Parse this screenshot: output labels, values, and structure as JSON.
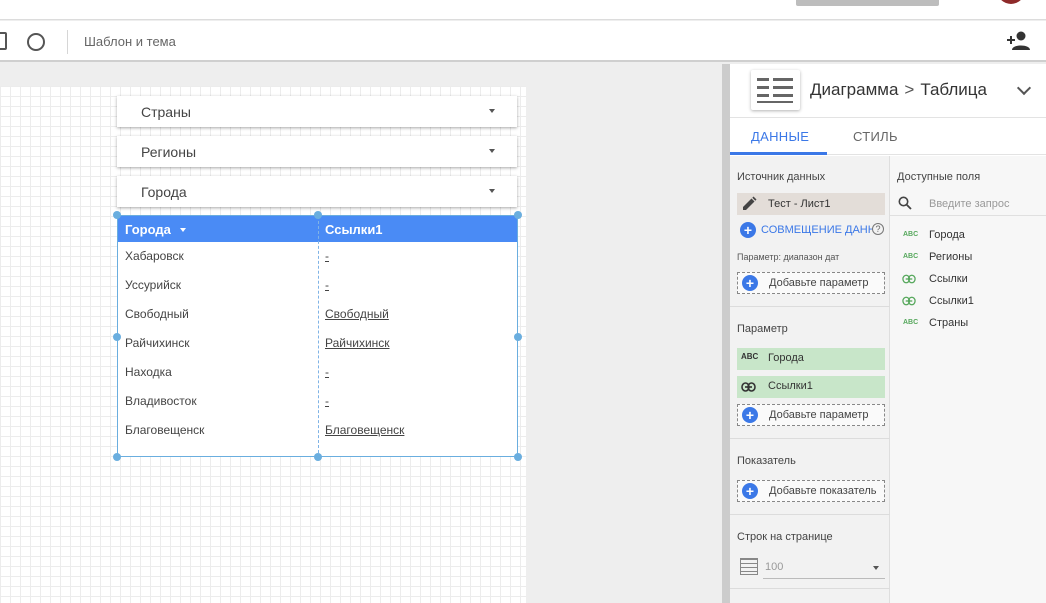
{
  "toolbar": {
    "theme_label": "Шаблон и тема"
  },
  "filters": [
    {
      "label": "Страны"
    },
    {
      "label": "Регионы"
    },
    {
      "label": "Города"
    }
  ],
  "table": {
    "columns": [
      "Города",
      "Ссылки1"
    ],
    "rows": [
      [
        "Хабаровск",
        "-"
      ],
      [
        "Уссурийск",
        "-"
      ],
      [
        "Свободный",
        "Свободный"
      ],
      [
        "Райчихинск",
        "Райчихинск"
      ],
      [
        "Находка",
        "-"
      ],
      [
        "Владивосток",
        "-"
      ],
      [
        "Благовещенск",
        "Благовещенск"
      ]
    ],
    "header_color": "#4a8bf5"
  },
  "panel": {
    "breadcrumb_first": "Диаграмма",
    "breadcrumb_sep": ">",
    "breadcrumb_second": "Таблица",
    "tabs": [
      {
        "label": "ДАННЫЕ",
        "active": true
      },
      {
        "label": "СТИЛЬ",
        "active": false
      }
    ],
    "data_source_title": "Источник данных",
    "data_source_name": "Тест - Лист1",
    "blend_label": "СОВМЕЩЕНИЕ ДАНН",
    "help_glyph": "?",
    "date_range_title": "Параметр: диапазон дат",
    "add_param_label": "Добавьте параметр",
    "dimension_title": "Параметр",
    "dimensions": [
      {
        "type": "ABC",
        "label": "Города"
      },
      {
        "type": "link",
        "label": "Ссылки1"
      }
    ],
    "add_param_label_2": "Добавьте параметр",
    "metric_title": "Показатель",
    "add_metric_label": "Добавьте показатель",
    "rows_per_page_title": "Строк на странице",
    "rows_per_page_value": "100",
    "available_fields_title": "Доступные поля",
    "search_placeholder": "Введите запрос",
    "fields": [
      {
        "type": "ABC",
        "label": "Города"
      },
      {
        "type": "ABC",
        "label": "Регионы"
      },
      {
        "type": "link",
        "label": "Ссылки"
      },
      {
        "type": "link",
        "label": "Ссылки1"
      },
      {
        "type": "ABC",
        "label": "Страны"
      }
    ],
    "accent_color": "#3b78e7",
    "chip_color": "#c8e6c9"
  },
  "icons": {
    "abc_glyph": "ABC",
    "plus_glyph": "+"
  }
}
